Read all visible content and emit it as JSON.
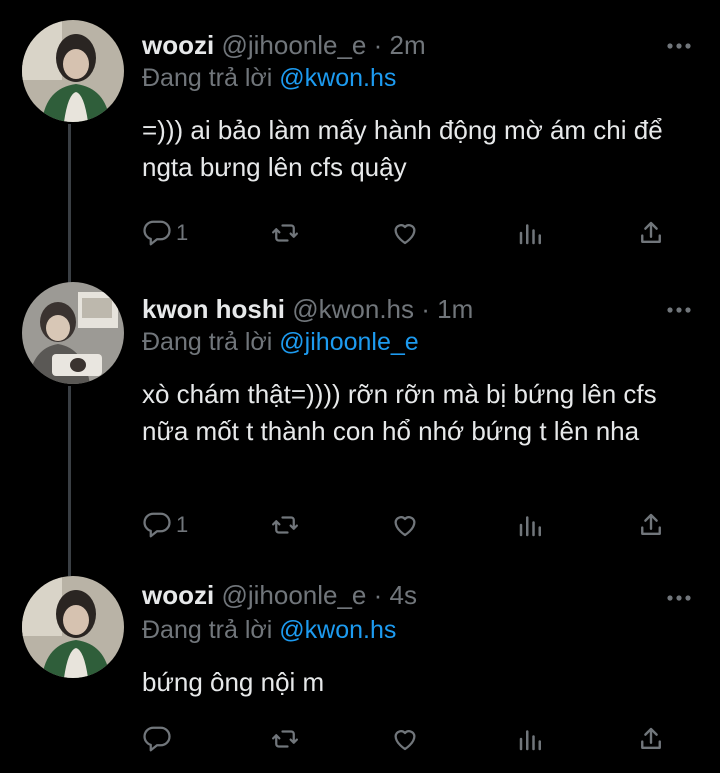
{
  "tweets": [
    {
      "name": "woozi",
      "handle": "@jihoonle_e",
      "time": "2m",
      "reply_prefix": "Đang trả lời",
      "reply_to": "@kwon.hs",
      "text": "=))) ai bảo làm mấy hành động mờ ám chi để ngta bưng lên cfs quậy",
      "reply_count": "1",
      "retweet_count": "",
      "like_count": ""
    },
    {
      "name": "kwon hoshi",
      "handle": "@kwon.hs",
      "time": "1m",
      "reply_prefix": "Đang trả lời",
      "reply_to": "@jihoonle_e",
      "text": "xò chám thật=)))) rỡn rỡn mà bị bứng lên cfs nữa mốt t thành con hổ nhớ bứng t lên nha",
      "reply_count": "1",
      "retweet_count": "",
      "like_count": ""
    },
    {
      "name": "woozi",
      "handle": "@jihoonle_e",
      "time": "4s",
      "reply_prefix": "Đang trả lời",
      "reply_to": "@kwon.hs",
      "text": "bứng ông nội m",
      "reply_count": "",
      "retweet_count": "",
      "like_count": ""
    }
  ],
  "separator": "·",
  "icons": {
    "reply": "reply-icon",
    "retweet": "retweet-icon",
    "like": "heart-icon",
    "views": "analytics-icon",
    "share": "share-icon",
    "more": "more-icon"
  },
  "colors": {
    "background": "#000000",
    "text": "#e7e9ea",
    "muted": "#71767b",
    "mention": "#1d9bf0",
    "thread_line": "#3a3f44"
  }
}
